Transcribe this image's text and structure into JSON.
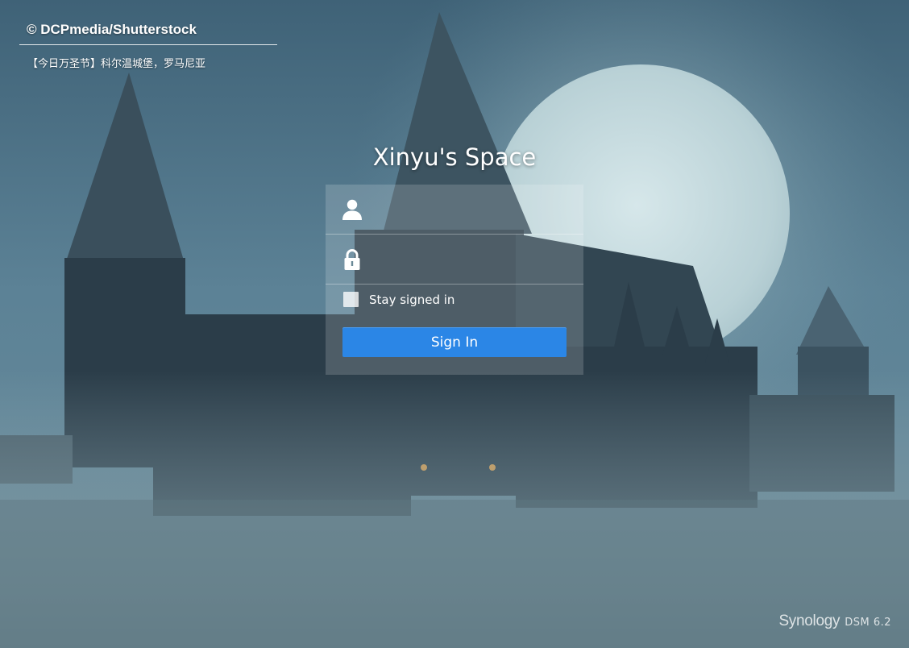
{
  "background": {
    "description_icon": "castle-night-wallpaper"
  },
  "credit": {
    "source": "© DCPmedia/Shutterstock",
    "caption": "【今日万圣节】科尔温城堡，罗马尼亚"
  },
  "login": {
    "title": "Xinyu's Space",
    "username": {
      "icon": "user-icon",
      "value": "",
      "placeholder": ""
    },
    "password": {
      "icon": "lock-icon",
      "value": "",
      "placeholder": ""
    },
    "stay_signed_in": {
      "label": "Stay signed in",
      "checked": false
    },
    "sign_in_label": "Sign In",
    "accent_color": "#2b86e6"
  },
  "brand": {
    "name": "Synology",
    "version": "DSM 6.2"
  }
}
